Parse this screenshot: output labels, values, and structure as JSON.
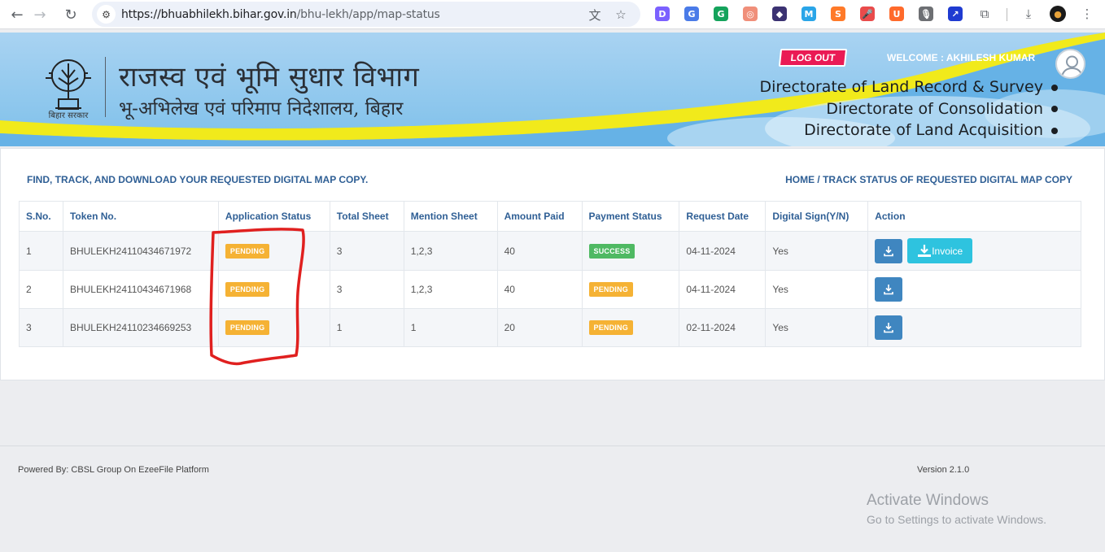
{
  "browser": {
    "url_host": "https://bhuabhilekh.bihar.gov.in",
    "url_path": "/bhu-lekh/app/map-status",
    "extensions": [
      {
        "name": "d-ext",
        "letter": "D",
        "color": "#7b61ff"
      },
      {
        "name": "translate-ext",
        "letter": "G",
        "color": "#4a7be8"
      },
      {
        "name": "grammarly-ext",
        "letter": "G",
        "color": "#15a35c"
      },
      {
        "name": "camera-ext",
        "letter": "◎",
        "color": "#f08f7a"
      },
      {
        "name": "puzzle-bird-ext",
        "letter": "◆",
        "color": "#3b3272"
      },
      {
        "name": "m-ext",
        "letter": "M",
        "color": "#2aa5e8"
      },
      {
        "name": "s-ext",
        "letter": "S",
        "color": "#ff7a29"
      },
      {
        "name": "mic-ext",
        "letter": "🎤",
        "color": "#e94b4b"
      },
      {
        "name": "u-ext",
        "letter": "U",
        "color": "#ff6a2b"
      },
      {
        "name": "voice-ext",
        "letter": "🎙",
        "color": "#6d6f73"
      },
      {
        "name": "chart-ext",
        "letter": "↗",
        "color": "#1f3bd1"
      }
    ]
  },
  "header": {
    "emblem_caption": "बिहार सरकार",
    "title": "राजस्व एवं भूमि सुधार विभाग",
    "subtitle": "भू-अभिलेख एवं परिमाप निदेशालय, बिहार",
    "logout_label": "LOG OUT",
    "welcome": "WELCOME : AKHILESH KUMAR",
    "directorates": [
      "Directorate of Land Record & Survey",
      "Directorate of Consolidation",
      "Directorate of Land Acquisition"
    ]
  },
  "page": {
    "heading_left": "FIND, TRACK, AND DOWNLOAD YOUR REQUESTED DIGITAL MAP COPY.",
    "breadcrumb": "HOME / TRACK STATUS OF REQUESTED DIGITAL MAP COPY"
  },
  "table": {
    "columns": [
      "S.No.",
      "Token No.",
      "Application Status",
      "Total Sheet",
      "Mention Sheet",
      "Amount Paid",
      "Payment Status",
      "Request Date",
      "Digital Sign(Y/N)",
      "Action"
    ],
    "rows": [
      {
        "sno": "1",
        "token": "BHULEKH24110434671972",
        "app_status": "PENDING",
        "total_sheet": "3",
        "mention_sheet": "1,2,3",
        "amount": "40",
        "payment_status": "SUCCESS",
        "date": "04-11-2024",
        "digital_sign": "Yes",
        "invoice_label": "Invoice"
      },
      {
        "sno": "2",
        "token": "BHULEKH24110434671968",
        "app_status": "PENDING",
        "total_sheet": "3",
        "mention_sheet": "1,2,3",
        "amount": "40",
        "payment_status": "PENDING",
        "date": "04-11-2024",
        "digital_sign": "Yes"
      },
      {
        "sno": "3",
        "token": "BHULEKH24110234669253",
        "app_status": "PENDING",
        "total_sheet": "1",
        "mention_sheet": "1",
        "amount": "20",
        "payment_status": "PENDING",
        "date": "02-11-2024",
        "digital_sign": "Yes"
      }
    ]
  },
  "footer": {
    "powered_by": "Powered By: CBSL Group On EzeeFile Platform",
    "version": "Version 2.1.0"
  },
  "windows_watermark": {
    "title": "Activate Windows",
    "subtitle": "Go to Settings to activate Windows."
  },
  "colors": {
    "accent_blue": "#2f5f95",
    "pending": "#f5b234",
    "success": "#4fb963",
    "download_btn": "#3f86c0",
    "invoice_btn": "#2ec3df",
    "logout": "#ea1a55",
    "annotation_red": "#e0201f"
  }
}
